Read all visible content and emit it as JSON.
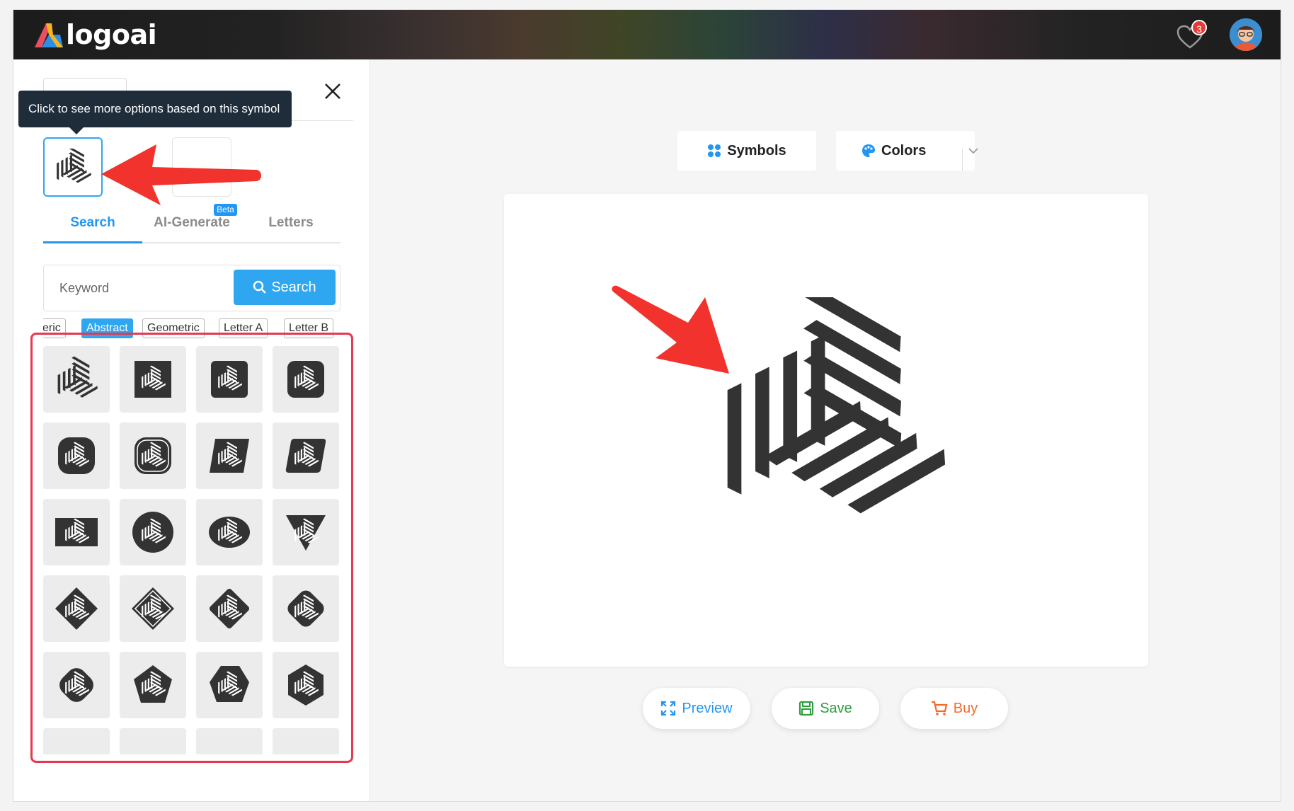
{
  "brand": {
    "name": "logoai"
  },
  "header": {
    "favorites_count": "3"
  },
  "sidebar": {
    "tooltip": "Click to see more options based on this symbol",
    "tabs": [
      {
        "label": "Search"
      },
      {
        "label": "AI-Generate",
        "badge": "Beta"
      },
      {
        "label": "Letters"
      }
    ],
    "search": {
      "placeholder": "Keyword",
      "button_label": "Search"
    },
    "chips": [
      {
        "label": "eric"
      },
      {
        "label": "Abstract"
      },
      {
        "label": "Geometric"
      },
      {
        "label": "Letter A"
      },
      {
        "label": "Letter B"
      }
    ],
    "grid_shapes": [
      "plain",
      "square",
      "rounded-square",
      "rounded-square-large",
      "squircle",
      "squircle-outline",
      "parallelogram",
      "parallelogram-rounded",
      "rectangle",
      "circle",
      "ellipse",
      "triangle-down",
      "diamond",
      "diamond-outline",
      "diamond-rounded",
      "diamond-soft",
      "octagon-round",
      "pentagon",
      "heptagon",
      "hexagon",
      "top-partial",
      "top-partial",
      "top-partial",
      "top-partial"
    ]
  },
  "main": {
    "toolbar": {
      "symbols_label": "Symbols",
      "colors_label": "Colors"
    },
    "actions": {
      "preview_label": "Preview",
      "save_label": "Save",
      "buy_label": "Buy"
    }
  },
  "colors": {
    "accent": "#2196f3",
    "save": "#2e9e3e",
    "buy": "#f26b2c",
    "annotation_red": "#f2322c",
    "symbol": "#333333"
  }
}
